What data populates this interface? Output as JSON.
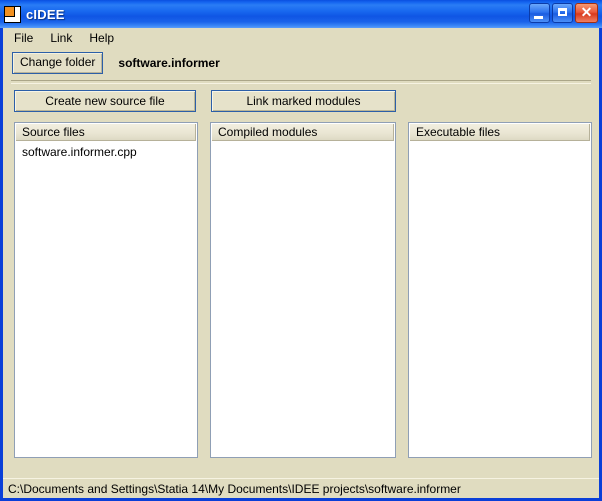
{
  "window": {
    "title": "cIDEE",
    "icon": "app-square-icon",
    "border_color": "#0a3fd8",
    "titlebar_gradient_accent": "#2a7cf5",
    "client_background": "#e0dcc0"
  },
  "titlebar_buttons": {
    "minimize": "minimize-icon",
    "maximize": "maximize-icon",
    "close_label": "✕",
    "close_color": "#d8391c"
  },
  "menubar": {
    "items": [
      {
        "label": "File"
      },
      {
        "label": "Link"
      },
      {
        "label": "Help"
      }
    ]
  },
  "toolbar": {
    "change_folder_label": "Change folder",
    "current_folder": "software.informer"
  },
  "actions": {
    "create_source_label": "Create new source file",
    "link_modules_label": "Link marked modules",
    "focus_border_color": "#2c5fa8"
  },
  "panels": [
    {
      "header": "Source files",
      "items": [
        "software.informer.cpp"
      ]
    },
    {
      "header": "Compiled modules",
      "items": []
    },
    {
      "header": "Executable files",
      "items": []
    }
  ],
  "statusbar": {
    "path": "C:\\Documents and Settings\\Statia 14\\My Documents\\IDEE projects\\software.informer"
  }
}
